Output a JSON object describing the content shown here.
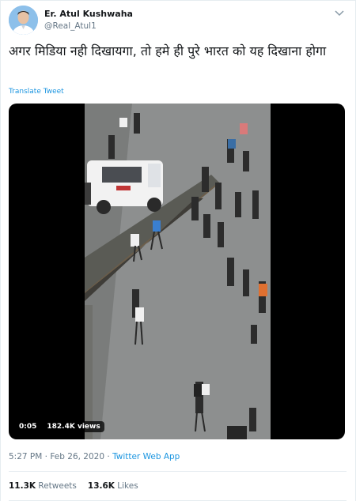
{
  "author": {
    "name": "Er. Atul Kushwaha",
    "handle": "@Real_Atul1"
  },
  "tweet": {
    "text": "अगर मिडिया नही दिखायगा, तो हमे ही पुरे भारत को यह दिखाना होगा",
    "translate_label": "Translate Tweet"
  },
  "video": {
    "time": "0:05",
    "views": "182.4K views"
  },
  "meta": {
    "time": "5:27 PM",
    "separator": "·",
    "date": "Feb 26, 2020",
    "app": "Twitter Web App"
  },
  "stats": {
    "retweets_count": "11.3K",
    "retweets_label": "Retweets",
    "likes_count": "13.6K",
    "likes_label": "Likes"
  },
  "colors": {
    "link": "#1b95e0",
    "secondary_text": "#657786",
    "primary_text": "#14171a"
  }
}
